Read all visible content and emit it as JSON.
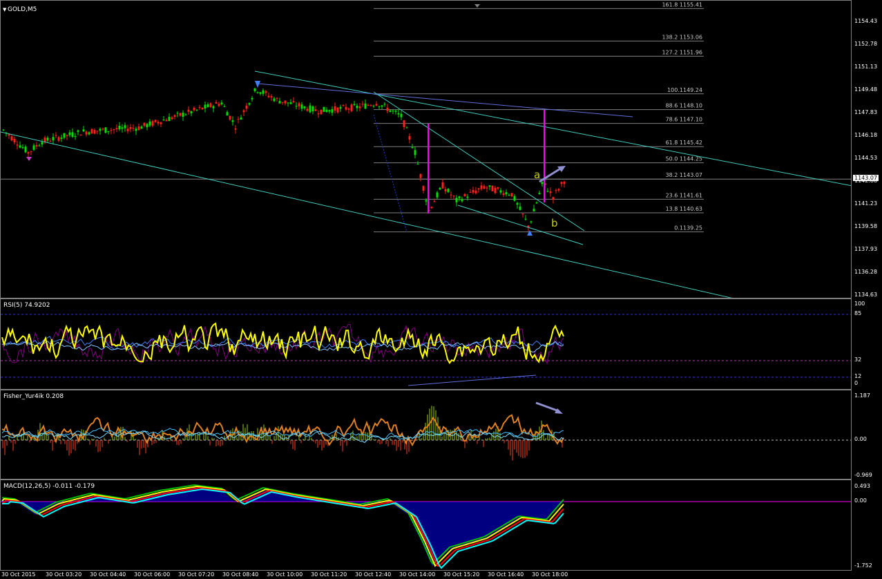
{
  "chart": {
    "symbol_label": "GOLD,M5",
    "current_price": "1143.07",
    "price_ticks": [
      "1154.43",
      "1152.78",
      "1151.13",
      "1149.48",
      "1147.83",
      "1146.18",
      "1144.53",
      "1142.88",
      "1141.23",
      "1139.58",
      "1137.93",
      "1136.28",
      "1134.63"
    ],
    "fib_levels": [
      {
        "label": "161.8 1155.41"
      },
      {
        "label": "138.2 1153.06"
      },
      {
        "label": "127.2 1151.96"
      },
      {
        "label": "100.1149.24"
      },
      {
        "label": "88.6 1148.10"
      },
      {
        "label": "78.6 1147.10"
      },
      {
        "label": "61.8 1145.42"
      },
      {
        "label": "50.0 1144.25"
      },
      {
        "label": "38.2 1143.07"
      },
      {
        "label": "23.6 1141.61"
      },
      {
        "label": "13.8 1140.63"
      },
      {
        "label": "0.1139.25"
      }
    ],
    "wave_labels": {
      "a": "a",
      "b": "b"
    }
  },
  "rsi": {
    "label": "RSI(5) 74.9202",
    "ticks": [
      "100",
      "85",
      "32",
      "12",
      "0"
    ]
  },
  "fisher": {
    "label": "Fisher_Yur4ik 0.208",
    "ticks": [
      "1.187",
      "0.00",
      "-0.969"
    ]
  },
  "macd": {
    "label": "MACD(12,26,5) -0.011 -0.179",
    "ticks": [
      "0.493",
      "0.00",
      "-1.752"
    ]
  },
  "time_axis": [
    "30 Oct 2015",
    "30 Oct 03:20",
    "30 Oct 04:40",
    "30 Oct 06:00",
    "30 Oct 07:20",
    "30 Oct 08:40",
    "30 Oct 10:00",
    "30 Oct 11:20",
    "30 Oct 12:40",
    "30 Oct 14:00",
    "30 Oct 15:20",
    "30 Oct 16:40",
    "30 Oct 18:00"
  ],
  "colors": {
    "bull": "#00e000",
    "bear": "#ff2020",
    "fib": "#808080",
    "channel": "#40d0c0",
    "magenta": "#ff00ff",
    "rsi": "#ffff00",
    "macd_hist": "#0000ff",
    "arrow": "#9090d0"
  }
}
